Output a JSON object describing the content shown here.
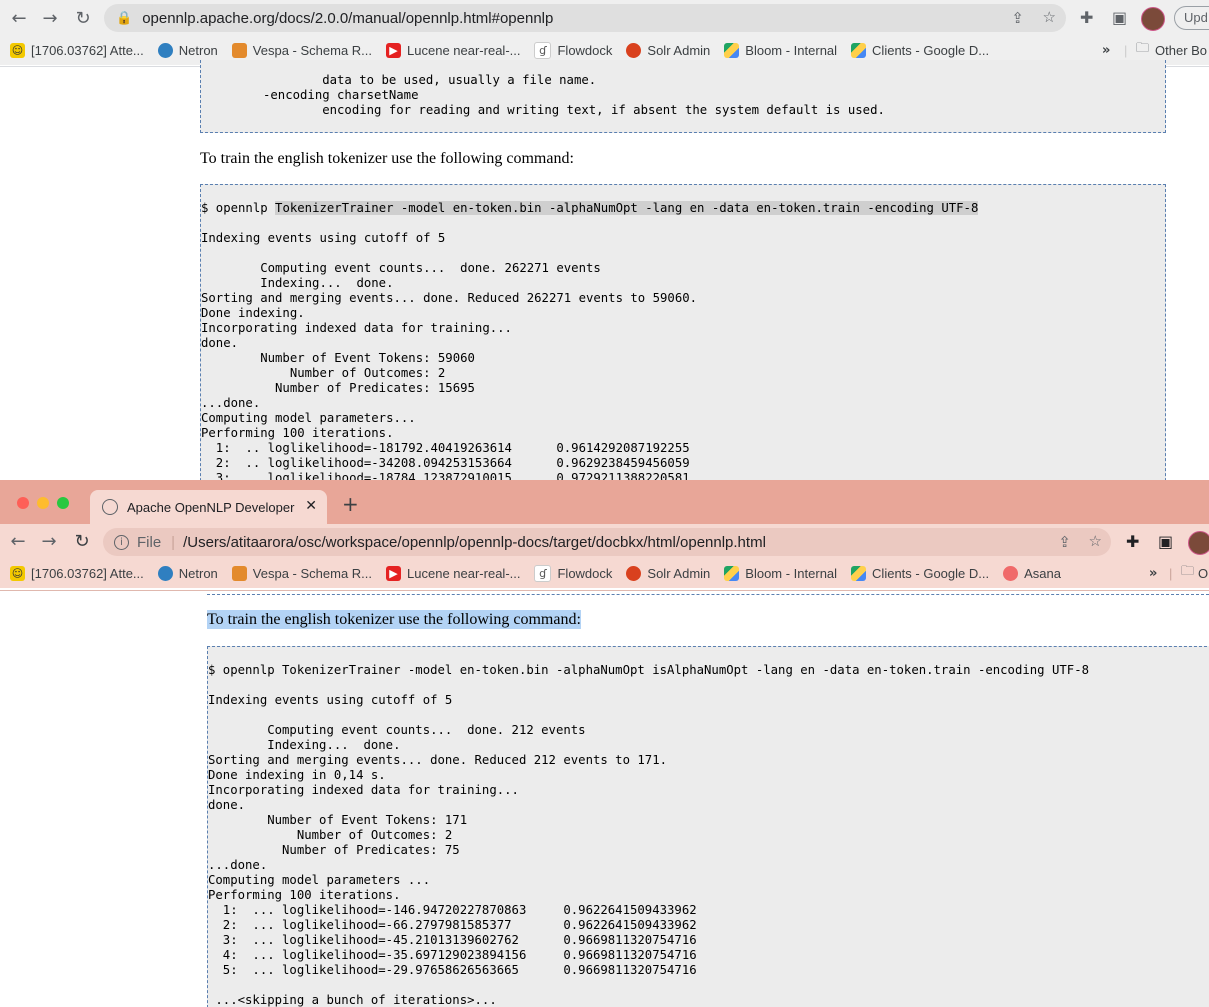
{
  "window1": {
    "url": "opennlp.apache.org/docs/2.0.0/manual/opennlp.html#opennlp",
    "update_label": "Upd",
    "bookmarks": [
      "[1706.03762] Atte...",
      "Netron",
      "Vespa - Schema R...",
      "Lucene near-real-...",
      "Flowdock",
      "Solr Admin",
      "Bloom - Internal",
      "Clients - Google D..."
    ],
    "other_bookmarks": "Other Bo",
    "top_code_lines": [
      "        data to be used, usually a file name.",
      "-encoding charsetName",
      "        encoding for reading and writing text, if absent the system default is used."
    ],
    "paragraph": "To train the english tokenizer use the following command:",
    "command_prompt": "$ opennlp ",
    "command_highlight": "TokenizerTrainer -model en-token.bin -alphaNumOpt -lang en -data en-token.train -encoding UTF-8",
    "output": "\nIndexing events using cutoff of 5\n\n        Computing event counts...  done. 262271 events\n        Indexing...  done.\nSorting and merging events... done. Reduced 262271 events to 59060.\nDone indexing.\nIncorporating indexed data for training...\ndone.\n        Number of Event Tokens: 59060\n            Number of Outcomes: 2\n          Number of Predicates: 15695\n...done.\nComputing model parameters...\nPerforming 100 iterations.\n  1:  .. loglikelihood=-181792.40419263614      0.9614292087192255\n  2:  .. loglikelihood=-34208.094253153664      0.9629238459456059\n  3:  .. loglikelihood=-18784.123872910015      0.9729211388220581"
  },
  "window2": {
    "tab_title": "Apache OpenNLP Developer Do",
    "file_label": "File",
    "url": "/Users/atitaarora/osc/workspace/opennlp/opennlp-docs/target/docbkx/html/opennlp.html",
    "bookmarks": [
      "[1706.03762] Atte...",
      "Netron",
      "Vespa - Schema R...",
      "Lucene near-real-...",
      "Flowdock",
      "Solr Admin",
      "Bloom - Internal",
      "Clients - Google D...",
      "Asana"
    ],
    "other_bookmarks": "O",
    "paragraph": "To train the english tokenizer use the following command:",
    "code": "$ opennlp TokenizerTrainer -model en-token.bin -alphaNumOpt isAlphaNumOpt -lang en -data en-token.train -encoding UTF-8\n\nIndexing events using cutoff of 5\n\n        Computing event counts...  done. 212 events\n        Indexing...  done.\nSorting and merging events... done. Reduced 212 events to 171.\nDone indexing in 0,14 s.\nIncorporating indexed data for training...\ndone.\n        Number of Event Tokens: 171\n            Number of Outcomes: 2\n          Number of Predicates: 75\n...done.\nComputing model parameters ...\nPerforming 100 iterations.\n  1:  ... loglikelihood=-146.94720227870863     0.9622641509433962\n  2:  ... loglikelihood=-66.2797981585377       0.9622641509433962\n  3:  ... loglikelihood=-45.21013139602762      0.9669811320754716\n  4:  ... loglikelihood=-35.697129023894156     0.9669811320754716\n  5:  ... loglikelihood=-29.97658626563665      0.9669811320754716\n\n ...<skipping a bunch of iterations>..."
  },
  "colors": {
    "toolbar1": "#efefef",
    "chrome2": "#e8a698",
    "toolbar2": "#f6d9d2",
    "selection": "#b3d3f5",
    "code_bg": "#ececec"
  },
  "icons": [
    "back-arrow-icon",
    "forward-arrow-icon",
    "reload-icon",
    "lock-icon",
    "info-icon",
    "share-icon",
    "star-icon",
    "extensions-icon",
    "sidepanel-icon",
    "folder-icon",
    "chevron-double-icon",
    "plus-icon",
    "close-icon"
  ]
}
